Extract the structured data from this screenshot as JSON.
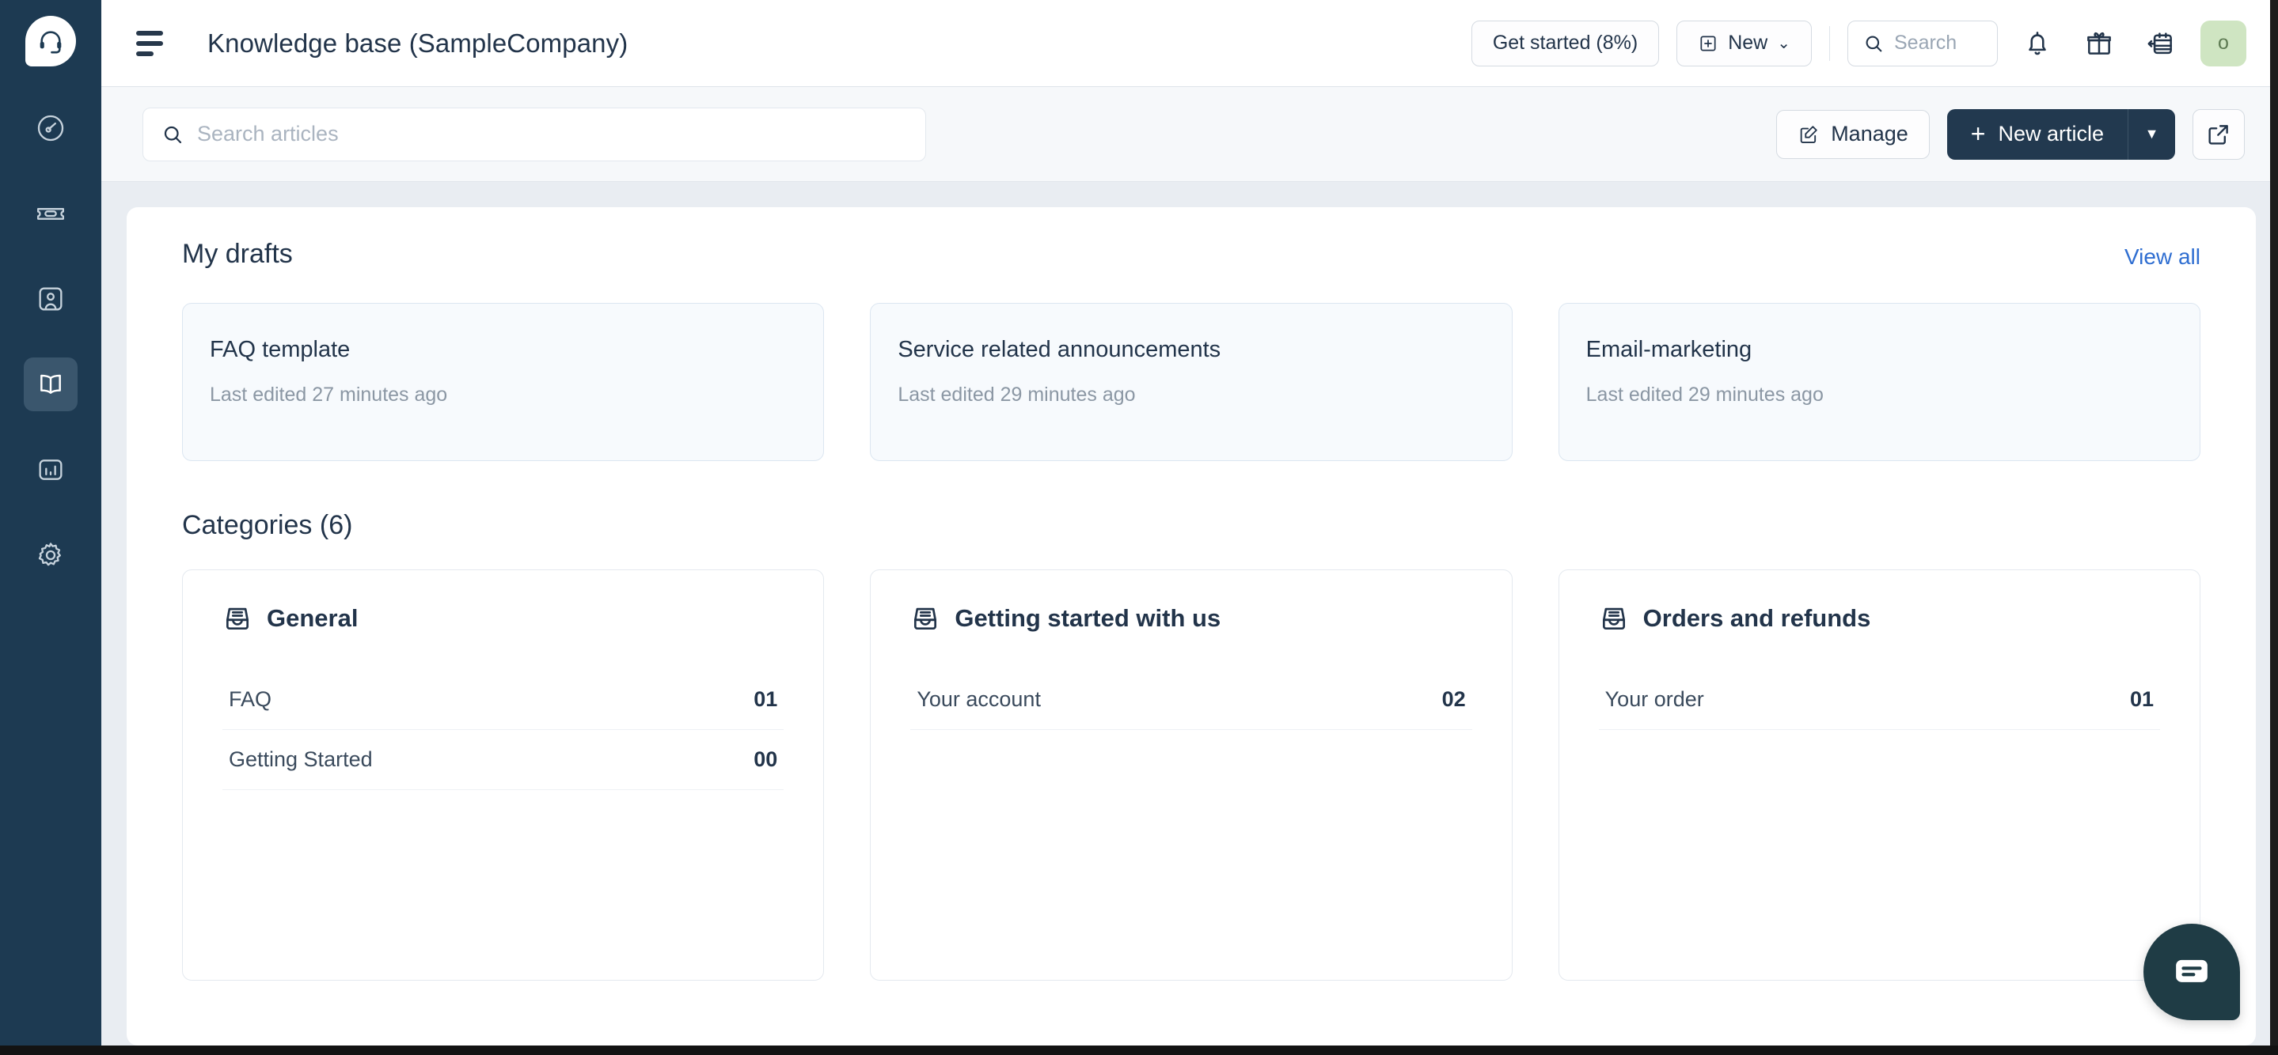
{
  "app": {
    "logo_icon": "headset-icon",
    "brand_color": "#1d3a52"
  },
  "sidebar": {
    "items": [
      {
        "name": "dashboard",
        "icon": "gauge-icon",
        "active": false
      },
      {
        "name": "tickets",
        "icon": "ticket-icon",
        "active": false
      },
      {
        "name": "contacts",
        "icon": "contact-card-icon",
        "active": false
      },
      {
        "name": "knowledge-base",
        "icon": "open-book-icon",
        "active": true
      },
      {
        "name": "reports",
        "icon": "bar-chart-icon",
        "active": false
      },
      {
        "name": "settings",
        "icon": "gear-icon",
        "active": false
      }
    ]
  },
  "header": {
    "menu_icon": "hamburger-icon",
    "title": "Knowledge base (SampleCompany)",
    "get_started_label": "Get started (8%)",
    "new_label": "New",
    "new_icon": "plus-square-icon",
    "new_caret": "⌄",
    "search_placeholder": "Search",
    "search_icon": "search-icon",
    "bell_icon": "bell-icon",
    "gift_icon": "gift-icon",
    "shortcuts_icon": "calendar-back-icon",
    "avatar_initial": "o",
    "avatar_color": "#cfe5c2"
  },
  "toolbar": {
    "search_placeholder": "Search articles",
    "search_icon": "search-icon",
    "manage_label": "Manage",
    "manage_icon": "edit-square-icon",
    "new_article_label": "New article",
    "new_article_plus": "+",
    "new_article_caret": "▼",
    "preview_icon": "external-link-icon",
    "primary_color": "#22394f"
  },
  "drafts": {
    "title": "My drafts",
    "view_all_label": "View all",
    "view_all_color": "#2f6ed1",
    "items": [
      {
        "title": "FAQ template",
        "subtitle": "Last edited 27 minutes ago"
      },
      {
        "title": "Service related announcements",
        "subtitle": "Last edited 29 minutes ago"
      },
      {
        "title": "Email-marketing",
        "subtitle": "Last edited 29 minutes ago"
      }
    ]
  },
  "categories": {
    "title": "Categories (6)",
    "icon": "inbox-tray-icon",
    "items": [
      {
        "name": "General",
        "rows": [
          {
            "label": "FAQ",
            "count": "01"
          },
          {
            "label": "Getting Started",
            "count": "00"
          }
        ]
      },
      {
        "name": "Getting started with us",
        "rows": [
          {
            "label": "Your account",
            "count": "02"
          }
        ]
      },
      {
        "name": "Orders and refunds",
        "rows": [
          {
            "label": "Your order",
            "count": "01"
          }
        ]
      }
    ]
  },
  "chat_widget": {
    "icon": "chat-bubble-icon",
    "color": "#1f3c45"
  }
}
